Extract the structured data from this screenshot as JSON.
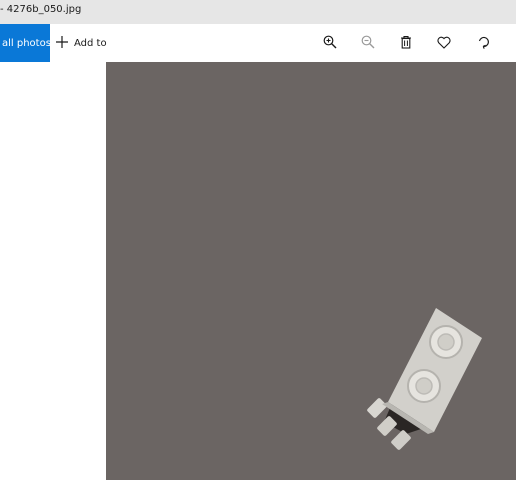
{
  "window": {
    "title": "- 4276b_050.jpg"
  },
  "toolbar": {
    "see_all_label": "all photos",
    "add_to_label": "Add to",
    "tools": [
      {
        "icon": "zoom-in-icon"
      },
      {
        "icon": "zoom-out-icon"
      },
      {
        "icon": "delete-icon"
      },
      {
        "icon": "heart-icon"
      },
      {
        "icon": "rotate-icon"
      }
    ]
  },
  "colors": {
    "accent": "#0a78d7",
    "titlebar": "#e6e6e6",
    "viewer_bg": "#6b6563"
  }
}
